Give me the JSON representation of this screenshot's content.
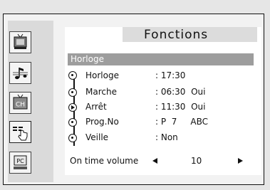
{
  "menu": {
    "title": "Fonctions",
    "section": "Horloge"
  },
  "sidebar": {
    "items": [
      {
        "name": "picture",
        "icon": "tv-picture-icon",
        "label": ""
      },
      {
        "name": "sound",
        "icon": "music-note-icon",
        "label": ""
      },
      {
        "name": "channel",
        "icon": "tv-channel-icon",
        "label": "CH"
      },
      {
        "name": "function",
        "icon": "function-hand-icon",
        "label": "",
        "active": true
      },
      {
        "name": "pc",
        "icon": "pc-icon",
        "label": "PC"
      }
    ]
  },
  "settings": [
    {
      "label": "Horloge",
      "value": ": 17:30"
    },
    {
      "label": "Marche",
      "value": ": 06:30  Oui"
    },
    {
      "label": "Arrêt",
      "value": ": 11:30  Oui"
    },
    {
      "label": "Prog.No",
      "value": ": P  7     ABC"
    },
    {
      "label": "Veille",
      "value": ": Non"
    }
  ],
  "volume": {
    "label": "On time volume",
    "value": "10"
  }
}
